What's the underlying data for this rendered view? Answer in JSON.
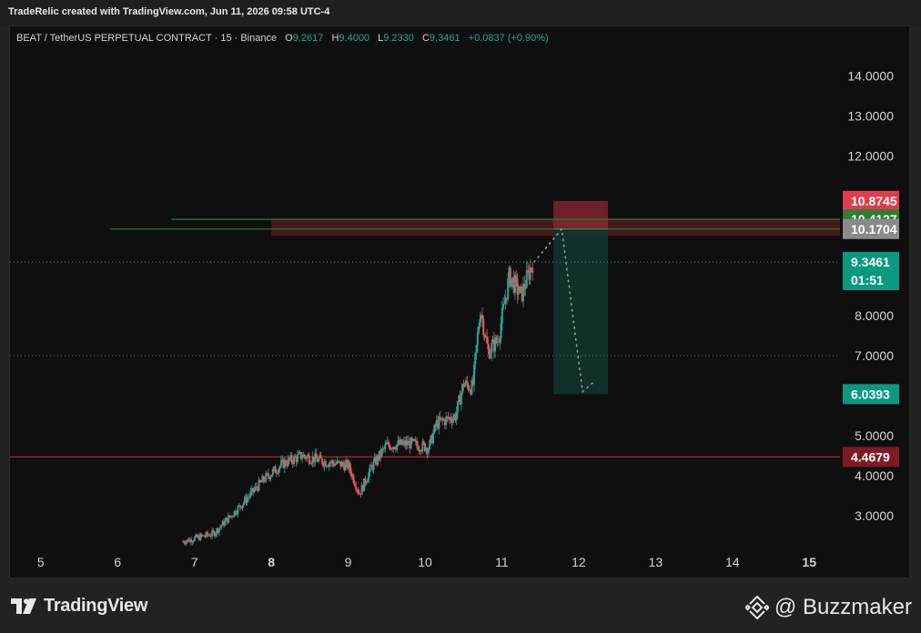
{
  "header": {
    "creator_line": "TradeRelic created with TradingView.com, Jun 11, 2026 09:58 UTC-4"
  },
  "legend": {
    "symbol": "BEAT / TetherUS PERPETUAL CONTRACT · 15 · Binance",
    "o_label": "O",
    "o_value": "9.2617",
    "h_label": "H",
    "h_value": "9.4000",
    "l_label": "L",
    "l_value": "9.2330",
    "c_label": "C",
    "c_value": "9.3461",
    "change": "+0.0837 (+0.90%)"
  },
  "footer": {
    "logo_text": "TradingView",
    "brand_text": "@ Buzzmaker"
  },
  "colors": {
    "background": "#0f0f0f",
    "up": "#26a69a",
    "down": "#ef5350",
    "stop_zone": "#5a1e22",
    "target_zone": "#12332c",
    "support_line": "#b2222a",
    "resistance_line": "#2e7d32"
  },
  "chart_data": {
    "type": "candlestick",
    "interval": "15",
    "x_ticks": [
      "5",
      "6",
      "7",
      "8",
      "9",
      "10",
      "11",
      "12",
      "13",
      "14",
      "15"
    ],
    "x_range": [
      4.6,
      15.4
    ],
    "y_ticks": [
      "3.0000",
      "4.0000",
      "5.0000",
      "7.0000",
      "8.0000",
      "12.0000",
      "13.0000",
      "14.0000"
    ],
    "ylim": [
      2.2,
      14.9
    ],
    "price_path": [
      {
        "x": 6.85,
        "y": 2.35
      },
      {
        "x": 7.25,
        "y": 2.55
      },
      {
        "x": 7.6,
        "y": 3.25
      },
      {
        "x": 7.9,
        "y": 3.9
      },
      {
        "x": 8.15,
        "y": 4.3
      },
      {
        "x": 8.4,
        "y": 4.5
      },
      {
        "x": 8.7,
        "y": 4.35
      },
      {
        "x": 9.0,
        "y": 4.25
      },
      {
        "x": 9.15,
        "y": 3.55
      },
      {
        "x": 9.3,
        "y": 4.2
      },
      {
        "x": 9.5,
        "y": 4.75
      },
      {
        "x": 9.8,
        "y": 4.8
      },
      {
        "x": 10.05,
        "y": 4.7
      },
      {
        "x": 10.15,
        "y": 5.3
      },
      {
        "x": 10.4,
        "y": 5.5
      },
      {
        "x": 10.5,
        "y": 6.3
      },
      {
        "x": 10.62,
        "y": 6.2
      },
      {
        "x": 10.72,
        "y": 8.2
      },
      {
        "x": 10.82,
        "y": 7.1
      },
      {
        "x": 10.95,
        "y": 7.4
      },
      {
        "x": 11.1,
        "y": 9.0
      },
      {
        "x": 11.25,
        "y": 8.5
      },
      {
        "x": 11.4,
        "y": 9.35
      }
    ],
    "projection": [
      {
        "x": 11.42,
        "y": 9.3461
      },
      {
        "x": 11.78,
        "y": 10.17
      },
      {
        "x": 12.05,
        "y": 6.1
      },
      {
        "x": 12.2,
        "y": 6.35
      }
    ],
    "levels": [
      {
        "label": "10.8745",
        "value": 10.8745,
        "color": "#e03c4a",
        "text_color": "#ffffff"
      },
      {
        "label": "10.4127",
        "value": 10.4127,
        "color": "#2e7d32",
        "text_color": "#ffffff"
      },
      {
        "label": "10.1704",
        "value": 10.1704,
        "color": "#8a8a8a",
        "text_color": "#ffffff"
      },
      {
        "label": "6.0393",
        "value": 6.0393,
        "color": "#089981",
        "text_color": "#ffffff"
      },
      {
        "label": "4.4679",
        "value": 4.4679,
        "color": "#7f1a22",
        "text_color": "#ffffff"
      }
    ],
    "current_price": {
      "label": "9.3461",
      "value": 9.3461,
      "countdown": "01:51",
      "color": "#089981"
    },
    "position": {
      "entry": 10.1704,
      "stop": 10.8745,
      "target": 6.0393,
      "x_start": 11.67,
      "x_end": 12.38
    },
    "resistance_zone": {
      "low": 10.0,
      "high": 10.4127,
      "x_start": 8.0
    },
    "horizontal_lines": [
      {
        "value": 10.4127,
        "x_start": 6.7,
        "color": "#2e7d32"
      },
      {
        "value": 10.17,
        "x_start": 5.9,
        "color": "#2e7d32"
      },
      {
        "value": 4.4679,
        "x_start": 4.6,
        "color": "#b2222a"
      }
    ],
    "dotted_lines": [
      9.3461,
      7.0
    ],
    "grid": false
  }
}
